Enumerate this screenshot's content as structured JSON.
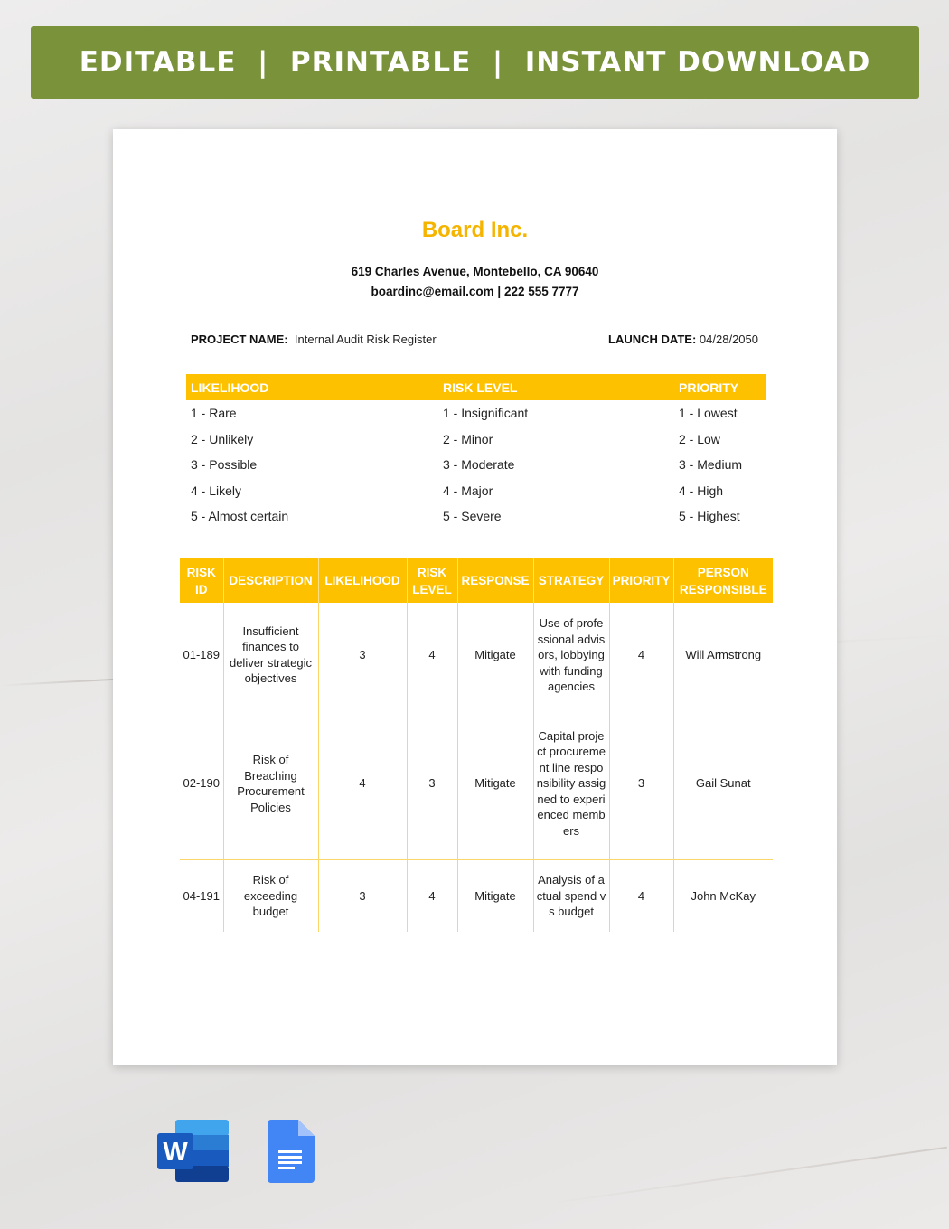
{
  "banner": {
    "items": [
      "EDITABLE",
      "PRINTABLE",
      "INSTANT DOWNLOAD"
    ],
    "text": "EDITABLE  |  PRINTABLE  |  INSTANT DOWNLOAD"
  },
  "document": {
    "company": "Board Inc.",
    "address": "619 Charles Avenue, Montebello, CA 90640",
    "contact": "boardinc@email.com | 222 555 7777",
    "project_label": "PROJECT NAME:",
    "project_value": "Internal Audit Risk Register",
    "launch_label": "LAUNCH DATE:",
    "launch_value": "04/28/2050",
    "legend": {
      "headers": [
        "LIKELIHOOD",
        "RISK LEVEL",
        "PRIORITY"
      ],
      "rows": [
        [
          "1 - Rare",
          "1 - Insignificant",
          "1 - Lowest"
        ],
        [
          "2 - Unlikely",
          "2 - Minor",
          "2 - Low"
        ],
        [
          "3 - Possible",
          "3 - Moderate",
          "3 - Medium"
        ],
        [
          "4 - Likely",
          "4 - Major",
          "4 - High"
        ],
        [
          "5 - Almost certain",
          "5 - Severe",
          "5 - Highest"
        ]
      ]
    },
    "risk_table": {
      "headers": [
        "RISK ID",
        "DESCRIPTION",
        "LIKELIHOOD",
        "RISK LEVEL",
        "RESPONSE",
        "STRATEGY",
        "PRIORITY",
        "PERSON RESPONSIBLE"
      ],
      "rows": [
        [
          "01-189",
          "Insufficient finances to deliver strategic objectives",
          "3",
          "4",
          "Mitigate",
          "Use of professional advisors, lobbying with funding agencies",
          "4",
          "Will Armstrong"
        ],
        [
          "02-190",
          "Risk of Breaching Procurement Policies",
          "4",
          "3",
          "Mitigate",
          "Capital project procurement line responsibility assigned to experienced members",
          "3",
          "Gail Sunat"
        ],
        [
          "04-191",
          "Risk of exceeding budget",
          "3",
          "4",
          "Mitigate",
          "Analysis of actual spend vs budget",
          "4",
          "John McKay"
        ]
      ]
    }
  },
  "icons": {
    "word": "microsoft-word-icon",
    "docs": "google-docs-icon"
  },
  "colors": {
    "banner": "#7a933b",
    "accent": "#fdc100",
    "company": "#f5b400"
  }
}
